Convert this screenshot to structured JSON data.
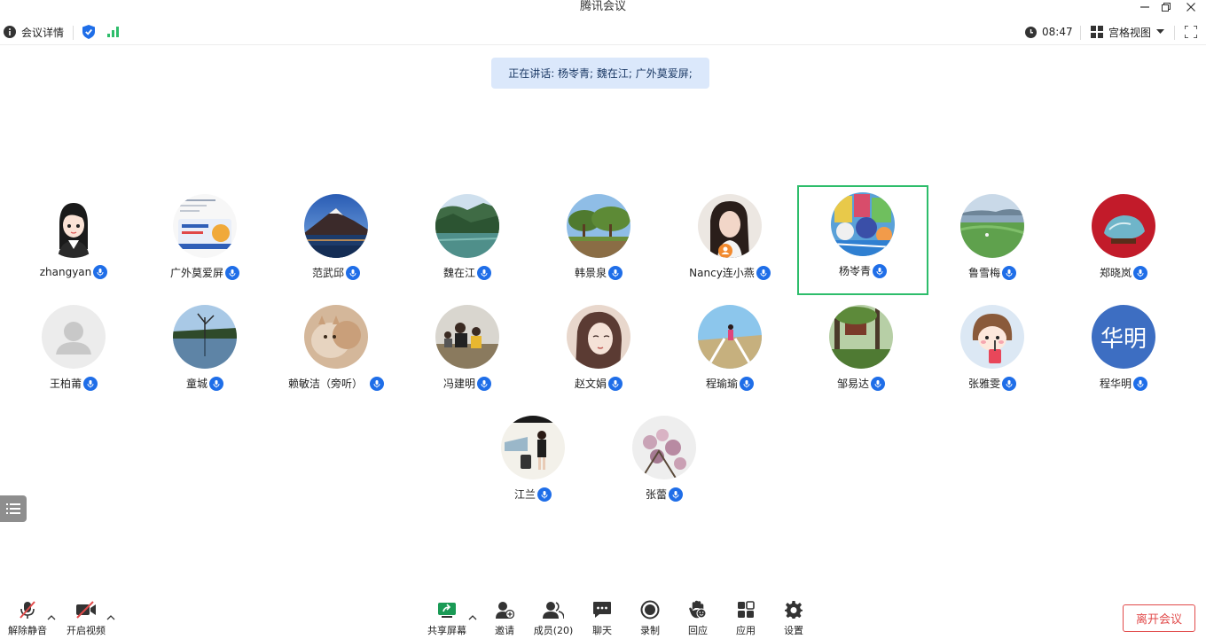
{
  "window": {
    "title": "腾讯会议"
  },
  "topbar": {
    "meeting_info": "会议详情",
    "time": "08:47",
    "view": "宫格视图"
  },
  "speaking": "正在讲话: 杨岺青; 魏在江; 广外莫爱屏;",
  "participants": [
    {
      "name": "zhangyan",
      "avatar": "cartoon-girl"
    },
    {
      "name": "广外莫爱屏",
      "avatar": "poster"
    },
    {
      "name": "范武邱",
      "avatar": "mountain-lake"
    },
    {
      "name": "魏在江",
      "avatar": "green-lake"
    },
    {
      "name": "韩景泉",
      "avatar": "tree-field"
    },
    {
      "name": "Nancy连小燕",
      "avatar": "woman-photo"
    },
    {
      "name": "杨岺青",
      "avatar": "colorful-painting"
    },
    {
      "name": "鲁雪梅",
      "avatar": "lakeside-bird"
    },
    {
      "name": "郑晓岚",
      "avatar": "stone-on-red"
    },
    {
      "name": "王柏莆",
      "avatar": "default-user"
    },
    {
      "name": "童城",
      "avatar": "tree-reflection"
    },
    {
      "name": "赖敏洁（旁听）",
      "avatar": "cat"
    },
    {
      "name": "冯建明",
      "avatar": "group-outdoor"
    },
    {
      "name": "赵文娟",
      "avatar": "painted-woman"
    },
    {
      "name": "程瑜瑜",
      "avatar": "boardwalk"
    },
    {
      "name": "邹易达",
      "avatar": "forest-sign"
    },
    {
      "name": "张雅雯",
      "avatar": "cartoon-girl-drink"
    },
    {
      "name": "程华明",
      "avatar": "initials",
      "initials": "华明"
    },
    {
      "name": "江兰",
      "avatar": "person-luggage"
    },
    {
      "name": "张蕾",
      "avatar": "blossoms"
    }
  ],
  "bottombar": {
    "unmute": "解除静音",
    "start_video": "开启视频",
    "share": "共享屏幕",
    "invite": "邀请",
    "members": "成员(20)",
    "chat": "聊天",
    "record": "录制",
    "reactions": "回应",
    "apps": "应用",
    "settings": "设置",
    "leave": "离开会议"
  },
  "colors": {
    "accent": "#1f6ee8",
    "active_speaker": "#2ebd6b",
    "leave": "#e14a4a",
    "banner": "#dbe8fb"
  }
}
